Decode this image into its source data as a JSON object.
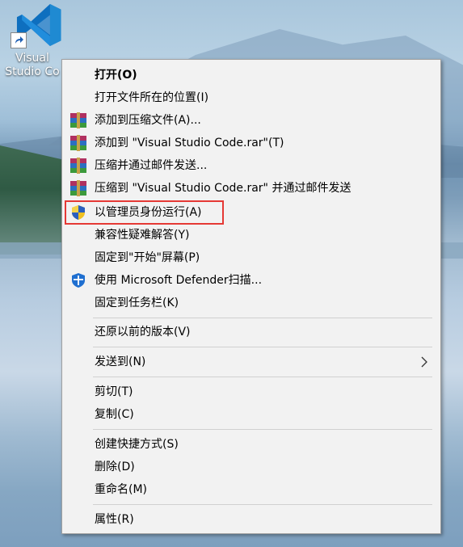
{
  "desktop": {
    "icon_label": "Visual\nStudio Co"
  },
  "menu": {
    "items": [
      {
        "label": "打开(O)",
        "icon": null,
        "bold": true
      },
      {
        "label": "打开文件所在的位置(I)",
        "icon": null
      },
      {
        "label": "添加到压缩文件(A)...",
        "icon": "winrar-icon"
      },
      {
        "label": "添加到 \"Visual Studio Code.rar\"(T)",
        "icon": "winrar-icon"
      },
      {
        "label": "压缩并通过邮件发送...",
        "icon": "winrar-icon"
      },
      {
        "label": "压缩到 \"Visual Studio Code.rar\" 并通过邮件发送",
        "icon": "winrar-icon"
      },
      {
        "label": "以管理员身份运行(A)",
        "icon": "uac-shield-icon",
        "highlighted": true
      },
      {
        "label": "兼容性疑难解答(Y)",
        "icon": null
      },
      {
        "label": "固定到\"开始\"屏幕(P)",
        "icon": null
      },
      {
        "label": "使用 Microsoft Defender扫描...",
        "icon": "defender-shield-icon"
      },
      {
        "label": "固定到任务栏(K)",
        "icon": null
      },
      {
        "label": "还原以前的版本(V)",
        "icon": null
      },
      {
        "label": "发送到(N)",
        "icon": null,
        "submenu": true
      },
      {
        "label": "剪切(T)",
        "icon": null
      },
      {
        "label": "复制(C)",
        "icon": null
      },
      {
        "label": "创建快捷方式(S)",
        "icon": null
      },
      {
        "label": "删除(D)",
        "icon": null
      },
      {
        "label": "重命名(M)",
        "icon": null
      },
      {
        "label": "属性(R)",
        "icon": null
      }
    ]
  },
  "colors": {
    "menu_bg": "#f2f2f2",
    "highlight_border": "#e53935",
    "vscode_blue": "#1f8ad2"
  }
}
